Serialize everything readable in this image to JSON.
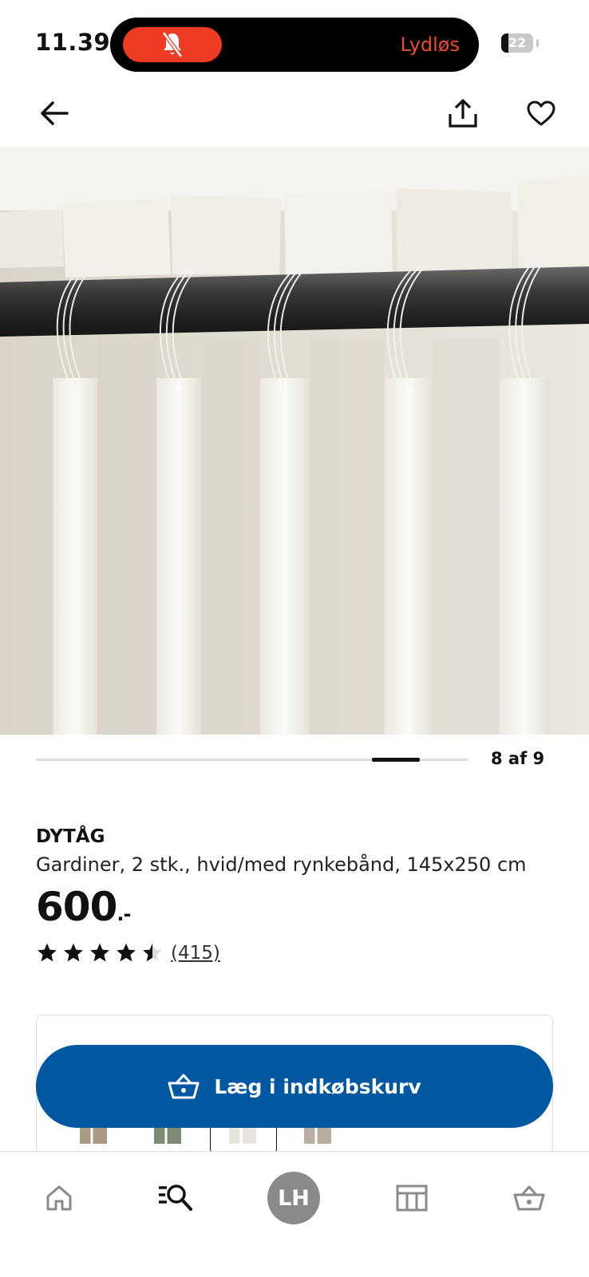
{
  "status_bar": {
    "time": "11.39",
    "silent_label": "Lydløs",
    "battery_level": "22",
    "battery_fraction": 0.22
  },
  "top_nav": {
    "back_icon": "arrow-left-icon",
    "share_icon": "share-icon",
    "favorite_icon": "heart-icon"
  },
  "gallery": {
    "counter": "8 af 9",
    "current_index": 8,
    "total": 9
  },
  "product": {
    "name": "DYTÅG",
    "description": "Gardiner, 2 stk., hvid/med rynkebånd, 145x250 cm",
    "price": "600",
    "price_suffix": ".-",
    "rating": 4.5,
    "review_count": "(415)"
  },
  "color_swatches": [
    {
      "color": "#a89a85"
    },
    {
      "color": "#7d8a74"
    },
    {
      "color": "#e8e4dc"
    },
    {
      "color": "#b9aca0"
    }
  ],
  "cta": {
    "label": "Læg i indkøbskurv",
    "icon": "shopping-basket-icon",
    "color": "#0058a3"
  },
  "tab_bar": {
    "home_icon": "home-icon",
    "search_icon": "search-list-icon",
    "avatar_initials": "LH",
    "store_icon": "store-icon",
    "basket_icon": "basket-icon"
  }
}
